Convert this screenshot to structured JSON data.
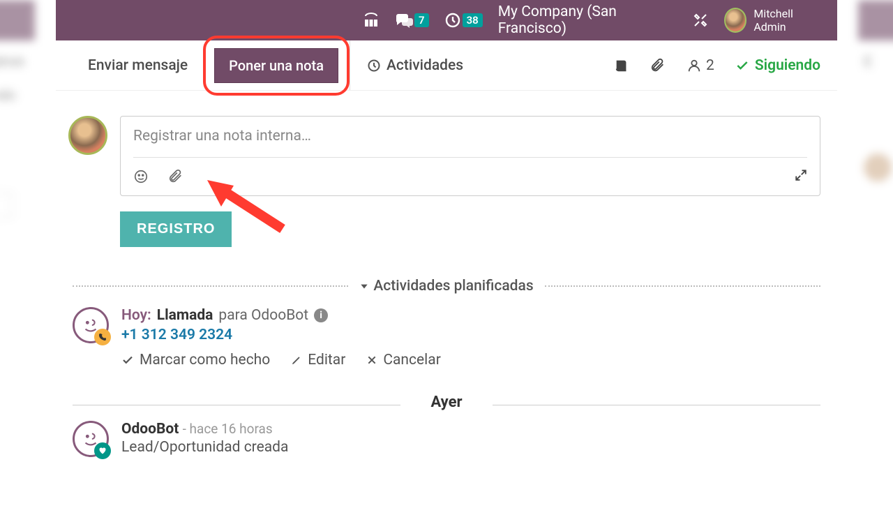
{
  "topbar": {
    "chat_badge": "7",
    "clock_badge": "38",
    "company": "My Company (San Francisco)",
    "user_name": "Mitchell Admin"
  },
  "tabs": {
    "send_message": "Enviar mensaje",
    "log_note": "Poner una nota",
    "activities": "Actividades"
  },
  "tab_right": {
    "followers_count": "2",
    "following": "Siguiendo"
  },
  "compose": {
    "placeholder": "Registrar una nota interna…",
    "submit": "REGISTRO"
  },
  "sections": {
    "planned": "Actividades planificadas",
    "yesterday": "Ayer"
  },
  "activity": {
    "today_label": "Hoy:",
    "type": "Llamada",
    "for": "para OdooBot",
    "phone": "+1 312 349 2324",
    "mark_done": "Marcar como hecho",
    "edit": "Editar",
    "cancel": "Cancelar"
  },
  "message": {
    "author": "OdooBot",
    "time": "- hace 16 horas",
    "text": "Lead/Oportunidad creada"
  }
}
